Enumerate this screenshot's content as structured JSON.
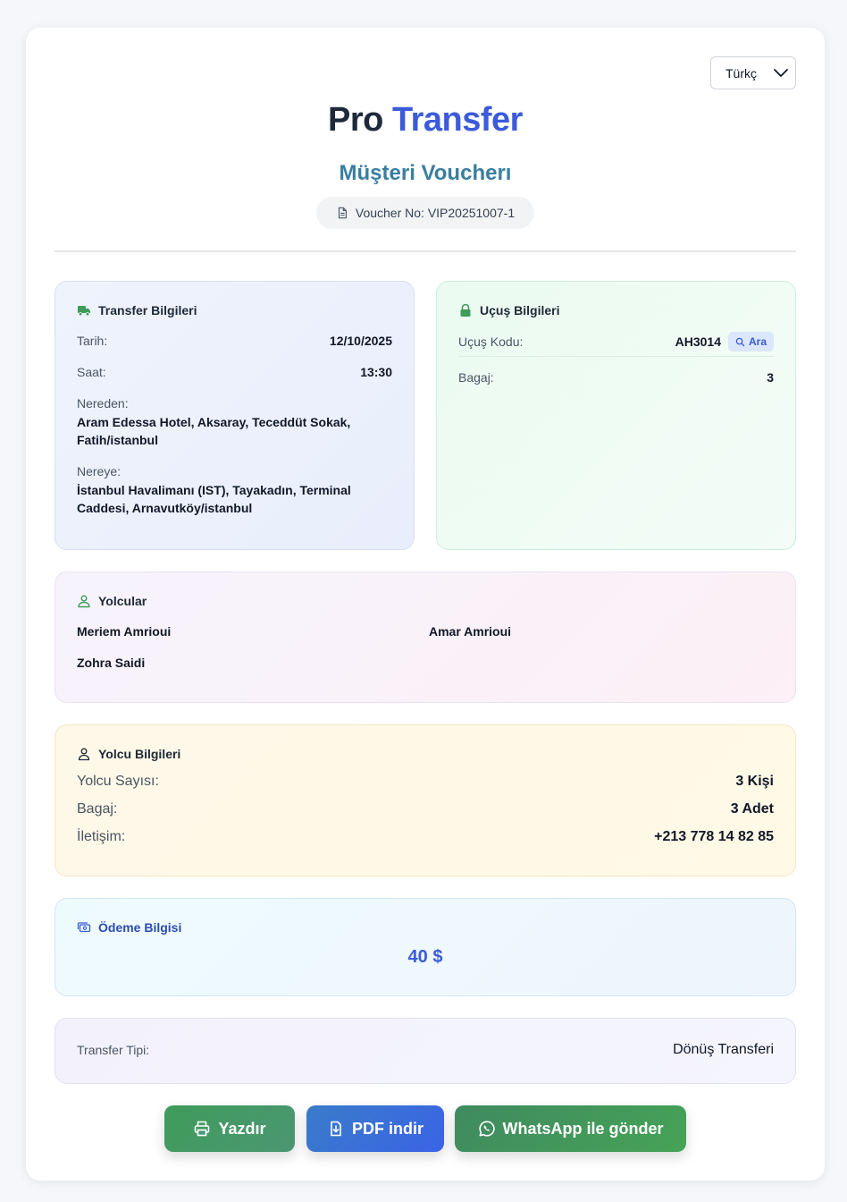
{
  "language": {
    "selected": "Türkç"
  },
  "brand": {
    "part1": "Pro",
    "part2": "Transfer"
  },
  "subtitle": "Müşteri Voucherı",
  "voucher": {
    "text": "Voucher No: VIP20251007-1"
  },
  "transfer": {
    "title": "Transfer Bilgileri",
    "date_label": "Tarih:",
    "date": "12/10/2025",
    "time_label": "Saat:",
    "time": "13:30",
    "from_label": "Nereden:",
    "from": "Aram Edessa Hotel, Aksaray, Teceddüt Sokak, Fatih/istanbul",
    "to_label": "Nereye:",
    "to": "İstanbul Havalimanı (IST), Tayakadın, Terminal Caddesi, Arnavutköy/istanbul"
  },
  "flight": {
    "title": "Uçuş Bilgileri",
    "code_label": "Uçuş Kodu:",
    "code": "AH3014",
    "search_label": "Ara",
    "baggage_label": "Bagaj:",
    "baggage": "3"
  },
  "passengers": {
    "title": "Yolcular",
    "names": [
      "Meriem Amrioui",
      "Amar Amrioui",
      "Zohra Saidi"
    ]
  },
  "passenger_info": {
    "title": "Yolcu Bilgileri",
    "count_label": "Yolcu Sayısı:",
    "count": "3 Kişi",
    "baggage_label": "Bagaj:",
    "baggage": "3 Adet",
    "contact_label": "İletişim:",
    "contact": "+213 778 14 82 85"
  },
  "payment": {
    "title": "Ödeme Bilgisi",
    "amount": "40 $"
  },
  "transfer_type": {
    "label": "Transfer Tipi:",
    "value": "Dönüş Transferi"
  },
  "actions": {
    "print": "Yazdır",
    "pdf": "PDF indir",
    "whatsapp": "WhatsApp ile gönder"
  },
  "colors": {
    "brand_dark": "#1e293b",
    "brand_blue": "#3b5bdb",
    "subtitle": "#3a7ea0",
    "icon_green": "#3f9c5a",
    "print_button": "#3f9c5a",
    "pdf_button": "#3a63e6",
    "whatsapp_button": "#46a356"
  },
  "icons": {
    "language": "chevron-down-icon",
    "voucher": "document-icon",
    "transfer": "truck-icon",
    "flight": "lock-icon",
    "search": "search-icon",
    "passengers": "users-icon",
    "passenger_info": "user-icon",
    "payment": "money-icon",
    "print": "printer-icon",
    "pdf": "file-download-icon",
    "whatsapp": "whatsapp-icon"
  }
}
